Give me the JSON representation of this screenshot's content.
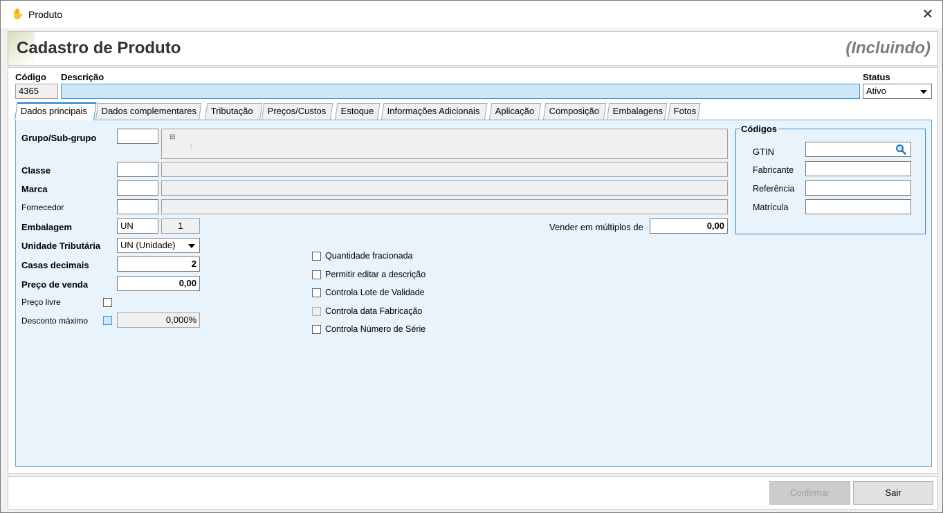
{
  "window": {
    "title": "Produto"
  },
  "header": {
    "title": "Cadastro de Produto",
    "mode": "(Incluindo)"
  },
  "fields": {
    "codigo": {
      "label": "Código",
      "value": "4365"
    },
    "descricao": {
      "label": "Descrição",
      "value": ""
    },
    "status": {
      "label": "Status",
      "value": "Ativo"
    }
  },
  "tabs": [
    {
      "label": "Dados principais",
      "active": true
    },
    {
      "label": "Dados complementares"
    },
    {
      "label": "Tributação"
    },
    {
      "label": "Preços/Custos"
    },
    {
      "label": "Estoque"
    },
    {
      "label": "Informações Adicionais"
    },
    {
      "label": "Aplicação"
    },
    {
      "label": "Composição"
    },
    {
      "label": "Embalagens"
    },
    {
      "label": "Fotos"
    }
  ],
  "main": {
    "grupo": {
      "label": "Grupo/Sub-grupo",
      "code": "",
      "tree_root": "⊟",
      "tree_branch": "⋮"
    },
    "classe": {
      "label": "Classe",
      "code": "",
      "desc": ""
    },
    "marca": {
      "label": "Marca",
      "code": "",
      "desc": ""
    },
    "fornecedor": {
      "label": "Fornecedor",
      "code": "",
      "desc": ""
    },
    "embalagem": {
      "label": "Embalagem",
      "unit": "UN",
      "qty": "1"
    },
    "unidade_tributaria": {
      "label": "Unidade Tributária",
      "value": "UN (Unidade)"
    },
    "casas_decimais": {
      "label": "Casas decimais",
      "value": "2"
    },
    "preco_venda": {
      "label": "Preço de venda",
      "value": "0,00"
    },
    "preco_livre": {
      "label": "Preço livre",
      "checked": false
    },
    "desconto_maximo": {
      "label": "Desconto máximo",
      "value": "0,000%",
      "checked": false
    },
    "vender_multiplos": {
      "label": "Vender em múltiplos de",
      "value": "0,00"
    }
  },
  "options": [
    {
      "label": "Quantidade fracionada",
      "checked": false,
      "enabled": true
    },
    {
      "label": "Permitir editar a descrição",
      "checked": false,
      "enabled": true
    },
    {
      "label": "Controla Lote de Validade",
      "checked": false,
      "enabled": true
    },
    {
      "label": "Controla data Fabricação",
      "checked": false,
      "enabled": false
    },
    {
      "label": "Controla Número de Série",
      "checked": false,
      "enabled": true
    }
  ],
  "codigos": {
    "title": "Códigos",
    "gtin": {
      "label": "GTIN",
      "value": ""
    },
    "fabricante": {
      "label": "Fabricante",
      "value": ""
    },
    "referencia": {
      "label": "Referência",
      "value": ""
    },
    "matricula": {
      "label": "Matrícula",
      "value": ""
    }
  },
  "footer": {
    "confirm_label": "Confirmar",
    "exit_label": "Sair"
  },
  "icons": {
    "app": "hand-icon",
    "close": "close-icon",
    "search": "search-icon",
    "dropdown": "chevron-down-icon"
  },
  "colors": {
    "accent": "#3d9bd8",
    "panel": "#e8f3fc",
    "field_highlight": "#cce8f7"
  }
}
